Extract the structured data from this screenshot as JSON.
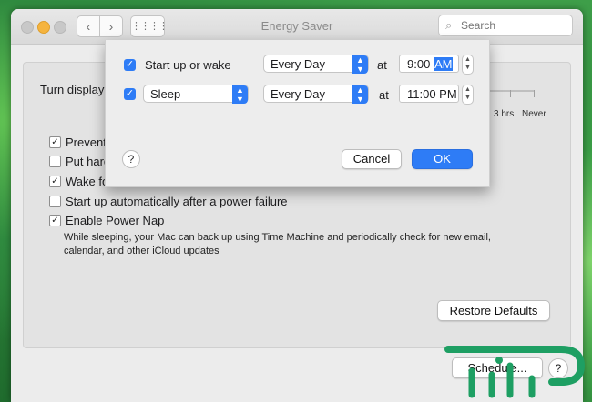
{
  "window": {
    "title": "Energy Saver",
    "search_placeholder": "Search"
  },
  "toolbar": {
    "back_glyph": "‹",
    "forward_glyph": "›",
    "grid_glyph": "⋮⋮⋮⋮"
  },
  "main": {
    "turn_display_label": "Turn display",
    "slider_labels": [
      "3 hrs",
      "Never"
    ],
    "options": [
      {
        "label": "Prevent",
        "checked": true
      },
      {
        "label": "Put hard",
        "checked": false
      },
      {
        "label": "Wake fo",
        "checked": true
      },
      {
        "label": "Start up automatically after a power failure",
        "checked": false
      },
      {
        "label": "Enable Power Nap",
        "checked": true
      }
    ],
    "power_nap_description": "While sleeping, your Mac can back up using Time Machine and periodically check for new email, calendar, and other iCloud updates",
    "restore_defaults_label": "Restore Defaults",
    "schedule_label": "Schedule...",
    "help_label": "?"
  },
  "schedule_sheet": {
    "row1": {
      "checked": true,
      "label": "Start up or wake",
      "frequency": "Every Day",
      "at_label": "at",
      "time": "9:00",
      "ampm": "AM"
    },
    "row2": {
      "checked": true,
      "action": "Sleep",
      "frequency": "Every Day",
      "at_label": "at",
      "time": "11:00 PM"
    },
    "help_label": "?",
    "cancel_label": "Cancel",
    "ok_label": "OK"
  },
  "colors": {
    "accent": "#2e7cf6",
    "minimize_light": "#f5b43f",
    "logo_green": "#1e9f63"
  }
}
